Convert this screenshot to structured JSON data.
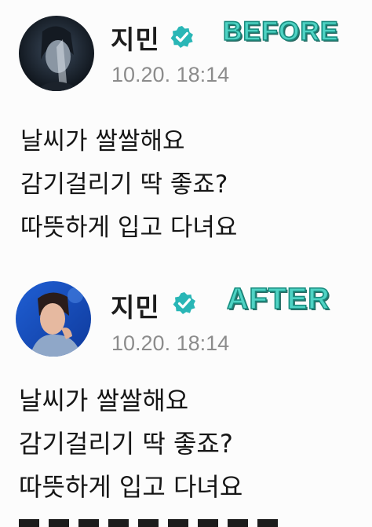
{
  "before": {
    "label": "BEFORE",
    "username": "지민",
    "timestamp": "10.20. 18:14",
    "lines": [
      "날씨가 쌀쌀해요",
      "감기걸리기 딱 좋죠?",
      "따뜻하게 입고 다녀요"
    ]
  },
  "after": {
    "label": "AFTER",
    "username": "지민",
    "timestamp": "10.20. 18:14",
    "lines": [
      "날씨가 쌀쌀해요",
      "감기걸리기 딱 좋죠?",
      "따뜻하게 입고 다녀요"
    ]
  },
  "colors": {
    "stamp": "#4fd3c4",
    "verified": "#29b6b6",
    "timestamp": "#8c8c8c"
  },
  "icons": [
    "verified-badge-icon"
  ]
}
